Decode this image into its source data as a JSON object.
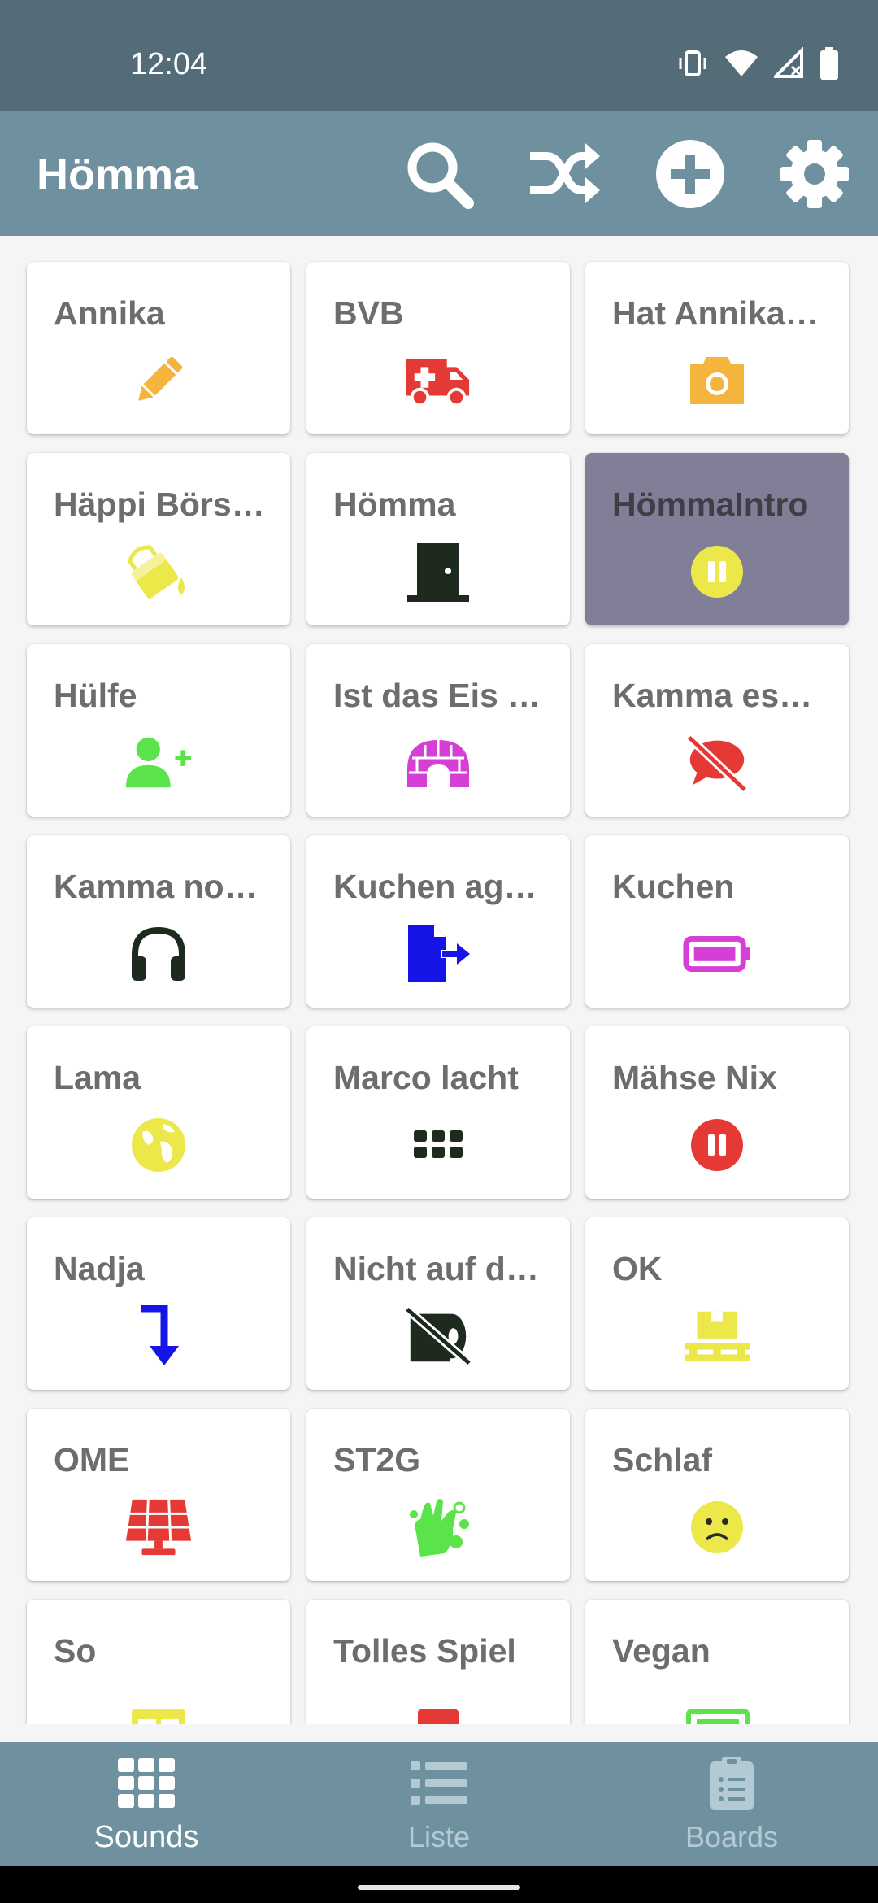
{
  "status_bar": {
    "time": "12:04"
  },
  "app_bar": {
    "title": "Hömma",
    "actions": [
      "search-icon",
      "shuffle-icon",
      "add-circle-icon",
      "settings-icon"
    ]
  },
  "sounds": [
    {
      "label": "Annika",
      "icon": "pencil-icon",
      "color": "#f5b43c"
    },
    {
      "label": "BVB",
      "icon": "ambulance-icon",
      "color": "#e53935"
    },
    {
      "label": "Hat Annika…",
      "icon": "camera-icon",
      "color": "#f5b43c"
    },
    {
      "label": "Häppi Börs…",
      "icon": "fill-bucket-icon",
      "color": "#ede84a"
    },
    {
      "label": "Hömma",
      "icon": "door-icon",
      "color": "#1d2a1d"
    },
    {
      "label": "HömmaIntro",
      "icon": "pause-circle-icon",
      "color": "#ede84a",
      "playing": true
    },
    {
      "label": "Hülfe",
      "icon": "user-plus-icon",
      "color": "#5be34a"
    },
    {
      "label": "Ist das Eis …",
      "icon": "igloo-icon",
      "color": "#d63fd6"
    },
    {
      "label": "Kamma es…",
      "icon": "comment-slash-icon",
      "color": "#e53935"
    },
    {
      "label": "Kamma no…",
      "icon": "headphones-icon",
      "color": "#1d2a1d"
    },
    {
      "label": "Kuchen ag…",
      "icon": "file-export-icon",
      "color": "#1515e8"
    },
    {
      "label": "Kuchen",
      "icon": "battery-icon",
      "color": "#d63fd6"
    },
    {
      "label": "Lama",
      "icon": "globe-icon",
      "color": "#ede84a"
    },
    {
      "label": "Marco lacht",
      "icon": "grid-dots-icon",
      "color": "#1d2a1d"
    },
    {
      "label": "Mähse Nix",
      "icon": "pause-circle-icon",
      "color": "#e53935"
    },
    {
      "label": "Nadja",
      "icon": "level-down-arrow-icon",
      "color": "#1515e8"
    },
    {
      "label": "Nicht auf d…",
      "icon": "toilet-paper-slash-icon",
      "color": "#1d2a1d"
    },
    {
      "label": "OK",
      "icon": "pallet-box-icon",
      "color": "#ede84a"
    },
    {
      "label": "OME",
      "icon": "solar-panel-icon",
      "color": "#e53935"
    },
    {
      "label": "ST2G",
      "icon": "hands-wash-icon",
      "color": "#5be34a"
    },
    {
      "label": "Schlaf",
      "icon": "frown-icon",
      "color": "#ede84a"
    },
    {
      "label": "So",
      "icon": "layout-icon",
      "color": "#ede84a"
    },
    {
      "label": "Tolles Spiel",
      "icon": "square-icon",
      "color": "#e53935"
    },
    {
      "label": "Vegan",
      "icon": "newspaper-icon",
      "color": "#5be34a"
    }
  ],
  "bottom_nav": [
    {
      "label": "Sounds",
      "icon": "grid-icon",
      "active": true
    },
    {
      "label": "Liste",
      "icon": "list-icon",
      "active": false
    },
    {
      "label": "Boards",
      "icon": "clipboard-list-icon",
      "active": false
    }
  ]
}
